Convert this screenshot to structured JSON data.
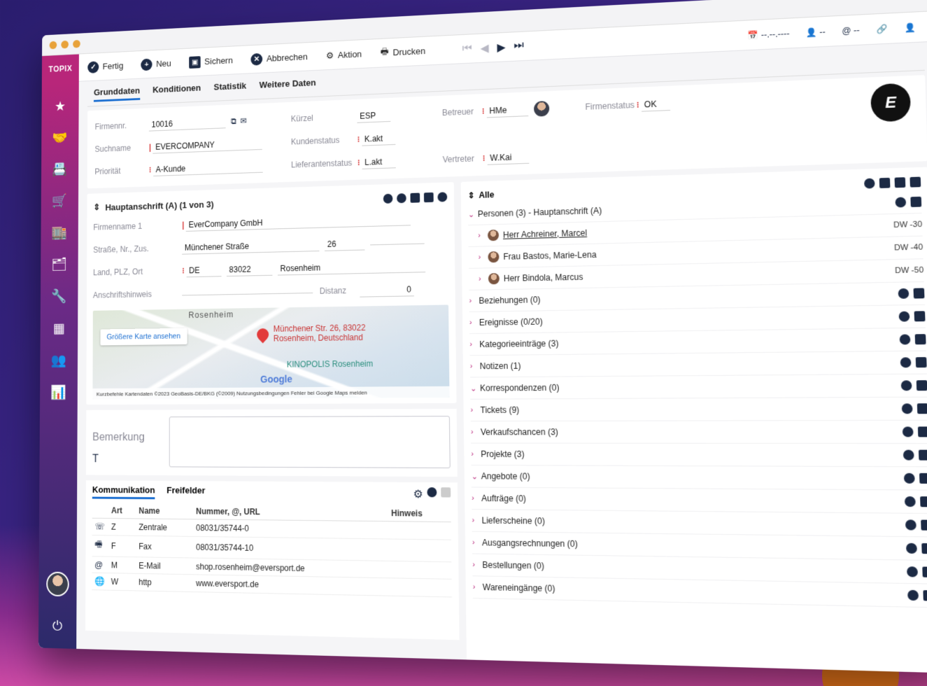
{
  "toolbar": {
    "brand": "TOPIX",
    "buttons": [
      "Fertig",
      "Neu",
      "Sichern",
      "Abbrechen",
      "Aktion",
      "Drucken"
    ],
    "date": "--.--.----",
    "user1": "--",
    "user2": "--"
  },
  "tabs": [
    "Grunddaten",
    "Konditionen",
    "Statistik",
    "Weitere Daten"
  ],
  "form": {
    "firmennr_label": "Firmennr.",
    "firmennr": "10016",
    "suchname_label": "Suchname",
    "suchname": "EVERCOMPANY",
    "prioritaet_label": "Priorität",
    "prioritaet": "A-Kunde",
    "kuerzel_label": "Kürzel",
    "kuerzel": "ESP",
    "kundenstatus_label": "Kundenstatus",
    "kundenstatus": "K.akt",
    "lieferantenstatus_label": "Lieferantenstatus",
    "lieferantenstatus": "L.akt",
    "betreuer_label": "Betreuer",
    "betreuer": "HMe",
    "vertreter_label": "Vertreter",
    "vertreter": "W.Kai",
    "firmenstatus_label": "Firmenstatus",
    "firmenstatus": "OK"
  },
  "address": {
    "title": "Hauptanschrift (A) (1 von 3)",
    "firmenname_label": "Firmenname 1",
    "firmenname": "EverCompany GmbH",
    "strasse_label": "Straße, Nr., Zus.",
    "strasse": "Münchener Straße",
    "nr": "26",
    "land_label": "Land, PLZ, Ort",
    "land": "DE",
    "plz": "83022",
    "ort": "Rosenheim",
    "hinweis_label": "Anschriftshinweis",
    "distanz_label": "Distanz",
    "distanz": "0"
  },
  "map": {
    "button": "Größere Karte ansehen",
    "city": "Rosenheim",
    "address_line1": "Münchener Str. 26, 83022",
    "address_line2": "Rosenheim, Deutschland",
    "poi": "KINOPOLIS Rosenheim",
    "google": "Google",
    "footer": "Kurzbefehle   Kartendaten ©2023 GeoBasis-DE/BKG (©2009)   Nutzungsbedingungen   Fehler bei Google Maps melden"
  },
  "remark": {
    "label": "Bemerkung"
  },
  "communication": {
    "tabs": [
      "Kommunikation",
      "Freifelder"
    ],
    "columns": [
      "Art",
      "Name",
      "Nummer, @, URL",
      "Hinweis"
    ],
    "rows": [
      {
        "icon": "phone-icon",
        "art": "Z",
        "name": "Zentrale",
        "value": "08031/35744-0"
      },
      {
        "icon": "fax-icon",
        "art": "F",
        "name": "Fax",
        "value": "08031/35744-10"
      },
      {
        "icon": "at-icon",
        "art": "M",
        "name": "E-Mail",
        "value": "shop.rosenheim@eversport.de"
      },
      {
        "icon": "globe-icon",
        "art": "W",
        "name": "http",
        "value": "www.eversport.de"
      }
    ]
  },
  "tree": {
    "header": "Alle",
    "persons_header": "Personen (3) - Hauptanschrift (A)",
    "persons": [
      {
        "name": "Herr Achreiner, Marcel",
        "tag": "DW -30"
      },
      {
        "name": "Frau Bastos, Marie-Lena",
        "tag": "DW -40"
      },
      {
        "name": "Herr Bindola, Marcus",
        "tag": "DW -50"
      }
    ],
    "sections": [
      "Beziehungen (0)",
      "Ereignisse (0/20)",
      "Kategorieeinträge (3)",
      "Notizen (1)",
      "Korrespondenzen (0)",
      "Tickets (9)",
      "Verkaufschancen (3)",
      "Projekte (3)",
      "Angebote (0)",
      "Aufträge (0)",
      "Lieferscheine (0)",
      "Ausgangsrechnungen (0)",
      "Bestellungen (0)",
      "Wareneingänge (0)"
    ]
  },
  "colors": {
    "accent": "#b8267a",
    "navy": "#1c2a44",
    "link": "#1c6fd1",
    "required": "#d83a3a"
  }
}
